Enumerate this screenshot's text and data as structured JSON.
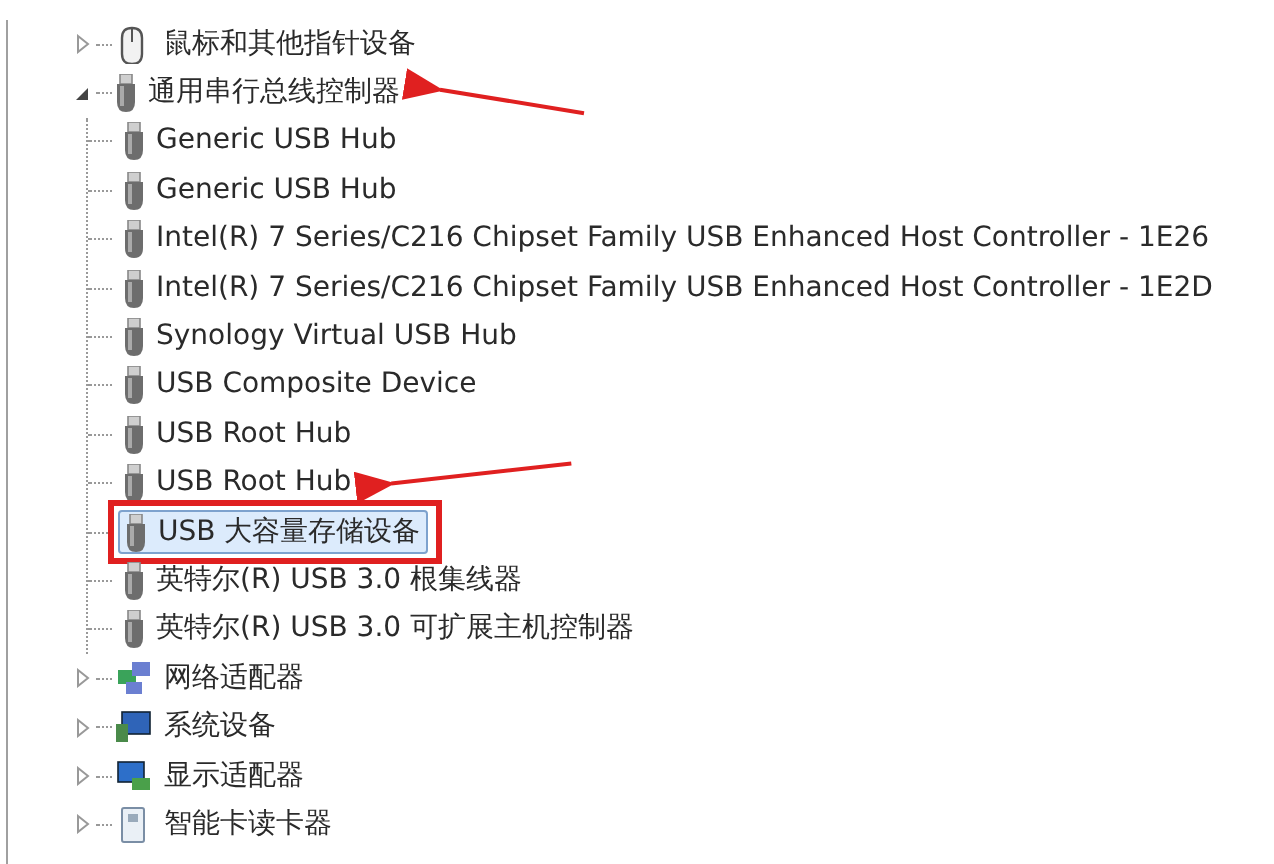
{
  "tree": [
    {
      "label": "鼠标和其他指针设备",
      "kind": "mouse",
      "expanded": false,
      "arrow": false
    },
    {
      "label": "通用串行总线控制器",
      "kind": "usb",
      "expanded": true,
      "arrow": true,
      "children": [
        {
          "label": "Generic USB Hub",
          "selected": false,
          "outlined": false,
          "arrow": false
        },
        {
          "label": "Generic USB Hub",
          "selected": false,
          "outlined": false,
          "arrow": false
        },
        {
          "label": "Intel(R) 7 Series/C216 Chipset Family USB Enhanced Host Controller - 1E26",
          "selected": false,
          "outlined": false,
          "arrow": false
        },
        {
          "label": "Intel(R) 7 Series/C216 Chipset Family USB Enhanced Host Controller - 1E2D",
          "selected": false,
          "outlined": false,
          "arrow": false
        },
        {
          "label": "Synology Virtual USB Hub",
          "selected": false,
          "outlined": false,
          "arrow": false
        },
        {
          "label": "USB Composite Device",
          "selected": false,
          "outlined": false,
          "arrow": false
        },
        {
          "label": "USB Root Hub",
          "selected": false,
          "outlined": false,
          "arrow": false
        },
        {
          "label": "USB Root Hub",
          "selected": false,
          "outlined": false,
          "arrow": true
        },
        {
          "label": "USB 大容量存储设备",
          "selected": true,
          "outlined": true,
          "arrow": false
        },
        {
          "label": "英特尔(R) USB 3.0 根集线器",
          "selected": false,
          "outlined": false,
          "arrow": false
        },
        {
          "label": "英特尔(R) USB 3.0 可扩展主机控制器",
          "selected": false,
          "outlined": false,
          "arrow": false
        }
      ]
    },
    {
      "label": "网络适配器",
      "kind": "network",
      "expanded": false,
      "arrow": false
    },
    {
      "label": "系统设备",
      "kind": "system",
      "expanded": false,
      "arrow": false
    },
    {
      "label": "显示适配器",
      "kind": "display",
      "expanded": false,
      "arrow": false
    },
    {
      "label": "智能卡读卡器",
      "kind": "smartcard",
      "expanded": false,
      "arrow": false
    }
  ]
}
